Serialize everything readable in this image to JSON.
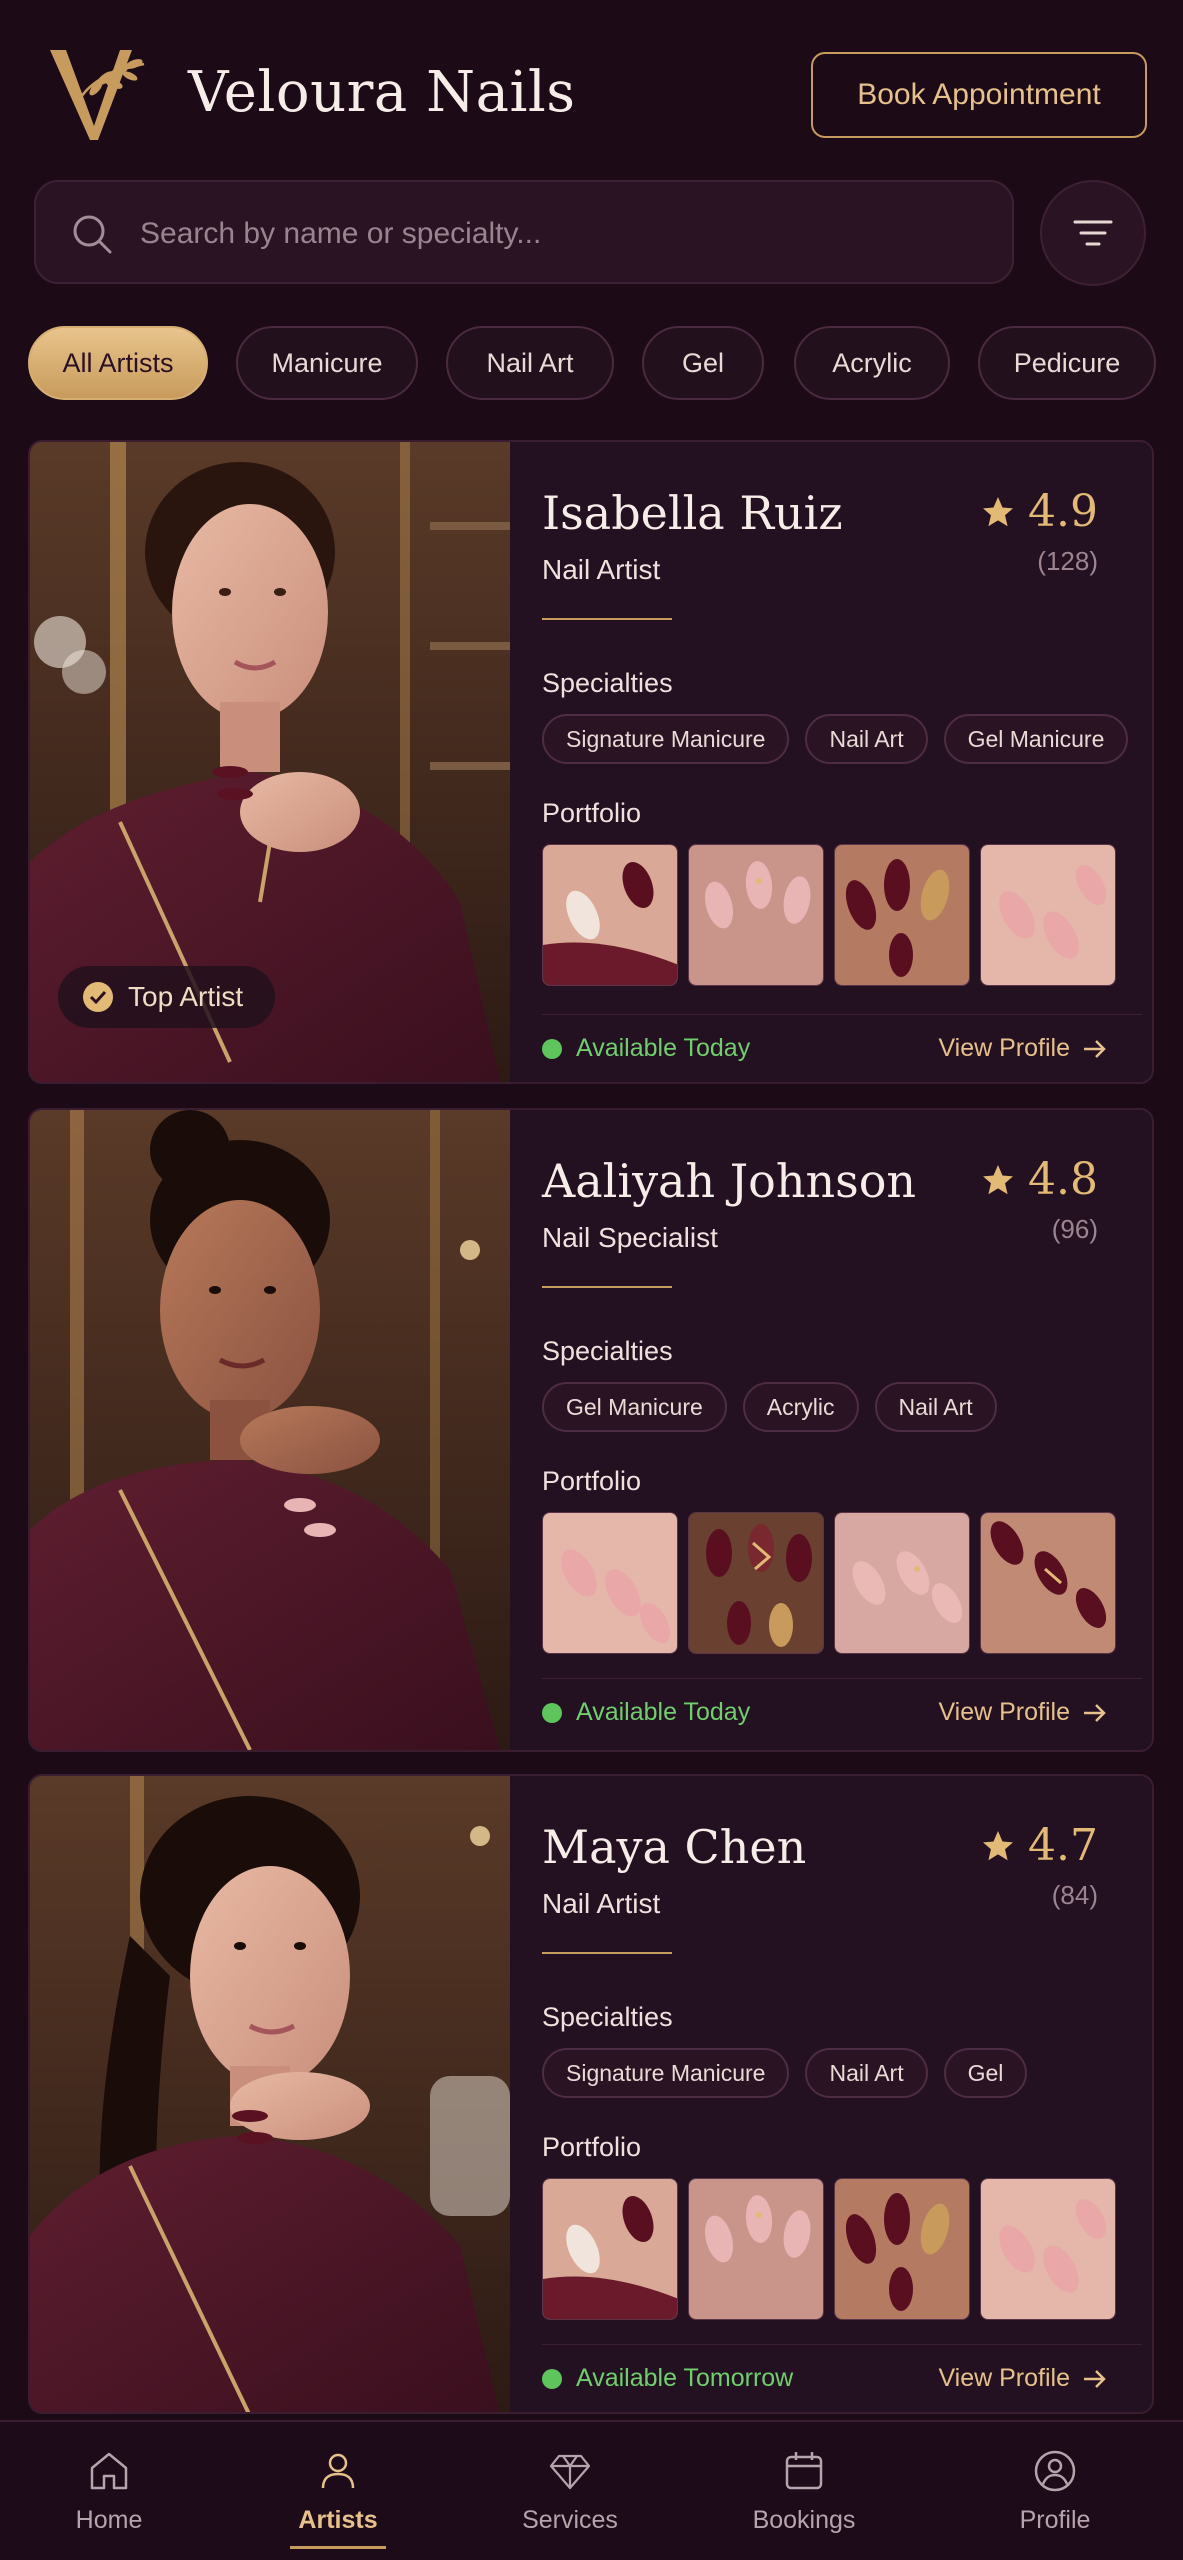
{
  "app": {
    "brand": "Veloura Nails",
    "book_button": "Book Appointment",
    "accent_color": "#c79b5e",
    "background_color": "#1c0a17"
  },
  "search": {
    "placeholder": "Search by name or specialty...",
    "value": ""
  },
  "filters": [
    {
      "label": "All Artists",
      "active": true
    },
    {
      "label": "Manicure",
      "active": false
    },
    {
      "label": "Nail Art",
      "active": false
    },
    {
      "label": "Gel",
      "active": false
    },
    {
      "label": "Acrylic",
      "active": false
    },
    {
      "label": "Pedicure",
      "active": false
    }
  ],
  "labels": {
    "specialties": "Specialties",
    "portfolio": "Portfolio",
    "view_profile": "View Profile"
  },
  "artists": [
    {
      "name": "Isabella Ruiz",
      "role": "Nail Artist",
      "rating": "4.9",
      "reviews": "(128)",
      "badge": "Top Artist",
      "specialties": [
        "Signature Manicure",
        "Nail Art",
        "Gel Manicure"
      ],
      "availability": "Available Today",
      "portfolio_icons": [
        "burgundy-marble-nails",
        "pink-gold-flake-nails",
        "burgundy-gold-nails",
        "nude-pink-nails"
      ]
    },
    {
      "name": "Aaliyah Johnson",
      "role": "Nail Specialist",
      "rating": "4.8",
      "reviews": "(96)",
      "badge": "",
      "specialties": [
        "Gel Manicure",
        "Acrylic",
        "Nail Art"
      ],
      "availability": "Available Today",
      "portfolio_icons": [
        "nude-pink-nails",
        "burgundy-gold-nails",
        "pink-gold-flake-nails",
        "burgundy-accent-nails"
      ]
    },
    {
      "name": "Maya Chen",
      "role": "Nail Artist",
      "rating": "4.7",
      "reviews": "(84)",
      "badge": "",
      "specialties": [
        "Signature Manicure",
        "Nail Art",
        "Gel"
      ],
      "availability": "Available Tomorrow",
      "portfolio_icons": [
        "burgundy-marble-nails",
        "pink-gold-flake-nails",
        "burgundy-gold-nails",
        "nude-pink-nails"
      ]
    }
  ],
  "nav": [
    {
      "label": "Home",
      "icon": "home-icon",
      "active": false
    },
    {
      "label": "Artists",
      "icon": "person-icon",
      "active": true
    },
    {
      "label": "Services",
      "icon": "diamond-icon",
      "active": false
    },
    {
      "label": "Bookings",
      "icon": "calendar-icon",
      "active": false
    },
    {
      "label": "Profile",
      "icon": "profile-icon",
      "active": false
    }
  ]
}
